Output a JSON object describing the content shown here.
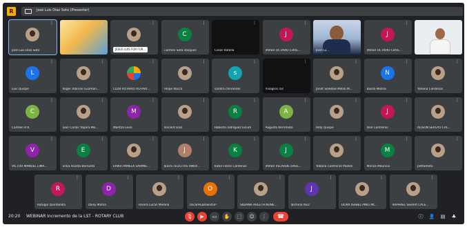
{
  "meeting": {
    "app_badge": "R",
    "presenter_label": "José Luis Díaz Soto (Presenter)",
    "time": "20:20",
    "title": "WEBINAR Incremento de la LST - ROTARY CLUB"
  },
  "colors": {
    "frame": "#202124",
    "tile": "#3c4043",
    "end_call": "#ea4335",
    "selected_outline": "#8ab4f8"
  },
  "rows": [
    {
      "tiles": [
        {
          "name": "José Luis Díaz Soto",
          "type": "photo",
          "selected": true
        },
        {
          "name": "",
          "type": "screen"
        },
        {
          "name": "JESUS LUIS FOR FUR...",
          "type": "photo",
          "labeled": true
        },
        {
          "name": "Carmen Sota Vasquez",
          "type": "initial",
          "initial": "C",
          "color": "#0b8043"
        },
        {
          "name": "Cesar Rotella",
          "type": "dark"
        },
        {
          "name": "JAVIER OCTAVIO CHVE...",
          "type": "initial",
          "initial": "J",
          "color": "#c2185b"
        },
        {
          "name": "José Lu...",
          "type": "video"
        },
        {
          "name": "JAVIER OCTAVIO CHVE...",
          "type": "initial",
          "initial": "J",
          "color": "#c2185b"
        },
        {
          "name": "",
          "type": "video2"
        }
      ]
    },
    {
      "tiles": [
        {
          "name": "Luis Quispe",
          "type": "initial",
          "initial": "L",
          "color": "#1a73e8"
        },
        {
          "name": "Roger Alarcón Guzmán...",
          "type": "photo"
        },
        {
          "name": "CLUB ROTARIO ROTARI...",
          "type": "logo"
        },
        {
          "name": "Felipe Rocca",
          "type": "photo"
        },
        {
          "name": "sandra cervantes",
          "type": "initial",
          "initial": "s",
          "color": "#12a4af"
        },
        {
          "name": "milagros ros",
          "type": "dark"
        },
        {
          "name": "Janet Soledad Millán M...",
          "type": "photo"
        },
        {
          "name": "Basilo Molina",
          "type": "initial",
          "initial": "N",
          "color": "#1a73e8"
        },
        {
          "name": "Yohana Cárdenas",
          "type": "photo"
        }
      ]
    },
    {
      "tiles": [
        {
          "name": "Carmen R.K.",
          "type": "initial",
          "initial": "C",
          "color": "#7cb342"
        },
        {
          "name": "Juan Carlos Yapara Mo...",
          "type": "photo"
        },
        {
          "name": "Maritza Leon",
          "type": "initial",
          "initial": "M",
          "color": "#8e24aa"
        },
        {
          "name": "Vincent Díaz",
          "type": "photo"
        },
        {
          "name": "Roberto rodríguez lucum",
          "type": "initial",
          "initial": "R",
          "color": "#0b8043"
        },
        {
          "name": "Augusto Kerrimoto",
          "type": "initial",
          "initial": "A",
          "color": "#7cb342"
        },
        {
          "name": "Aldy Quispe",
          "type": "photo"
        },
        {
          "name": "José Contreras",
          "type": "initial",
          "initial": "J",
          "color": "#c2185b"
        },
        {
          "name": "ALISON SERGYO CAC...",
          "type": "photo"
        }
      ]
    },
    {
      "tiles": [
        {
          "name": "VICTOR MANUEL LIMA...",
          "type": "initial",
          "initial": "V",
          "color": "#8e24aa"
        },
        {
          "name": "Erika Acosta Barrueta",
          "type": "initial",
          "initial": "E",
          "color": "#0b8043"
        },
        {
          "name": "ERIKA PAMELA SARMIE...",
          "type": "photo"
        },
        {
          "name": "JESUS FELICITAS ANUA...",
          "type": "initial",
          "initial": "J",
          "color": "#b07f6a"
        },
        {
          "name": "Katia Flores Cardenas",
          "type": "initial",
          "initial": "K",
          "color": "#0b8043"
        },
        {
          "name": "JAVIER VELARDE DAUL...",
          "type": "initial",
          "initial": "J",
          "color": "#0b8043"
        },
        {
          "name": "Yobana Contreras Muñoz",
          "type": "photo"
        },
        {
          "name": "Marisa Mauricio",
          "type": "initial",
          "initial": "M",
          "color": "#0b8043"
        },
        {
          "name": "pettamoto",
          "type": "photo"
        }
      ]
    },
    {
      "tiles": [
        {
          "name": "Rafugio Quintanilla",
          "type": "initial",
          "initial": "R",
          "color": "#c2185b"
        },
        {
          "name": "Daisy Mama",
          "type": "initial",
          "initial": "D",
          "color": "#8e24aa"
        },
        {
          "name": "Rivera Lucas Medina",
          "type": "photo"
        },
        {
          "name": "OscarHuaman4GP",
          "type": "initial",
          "initial": "O",
          "color": "#e8710a"
        },
        {
          "name": "SILVANA ARLETH NUÑE...",
          "type": "photo"
        },
        {
          "name": "Jasmina Ruiz",
          "type": "initial",
          "initial": "J",
          "color": "#5e35b1"
        },
        {
          "name": "DORA ISABEL PINO AK...",
          "type": "photo"
        },
        {
          "name": "RAPHAEL SIERRA CALE...",
          "type": "photo"
        }
      ]
    }
  ],
  "controls": [
    {
      "icon": "mic-off-icon",
      "glyph": "🎙",
      "red": true
    },
    {
      "icon": "camera-off-icon",
      "glyph": "▶",
      "red": true
    },
    {
      "icon": "captions-icon",
      "glyph": "▭"
    },
    {
      "icon": "hand-icon",
      "glyph": "✋"
    },
    {
      "icon": "present-icon",
      "glyph": "⬚"
    },
    {
      "icon": "emoji-icon",
      "glyph": "☺"
    },
    {
      "icon": "more-icon",
      "glyph": "⋮"
    }
  ],
  "end_call_glyph": "☎",
  "right_controls": [
    {
      "icon": "info-icon",
      "glyph": "ⓘ"
    },
    {
      "icon": "people-icon",
      "glyph": "👤"
    },
    {
      "icon": "chat-icon",
      "glyph": "▤"
    },
    {
      "icon": "activities-icon",
      "glyph": "♣"
    }
  ],
  "more_glyph": "⋮"
}
